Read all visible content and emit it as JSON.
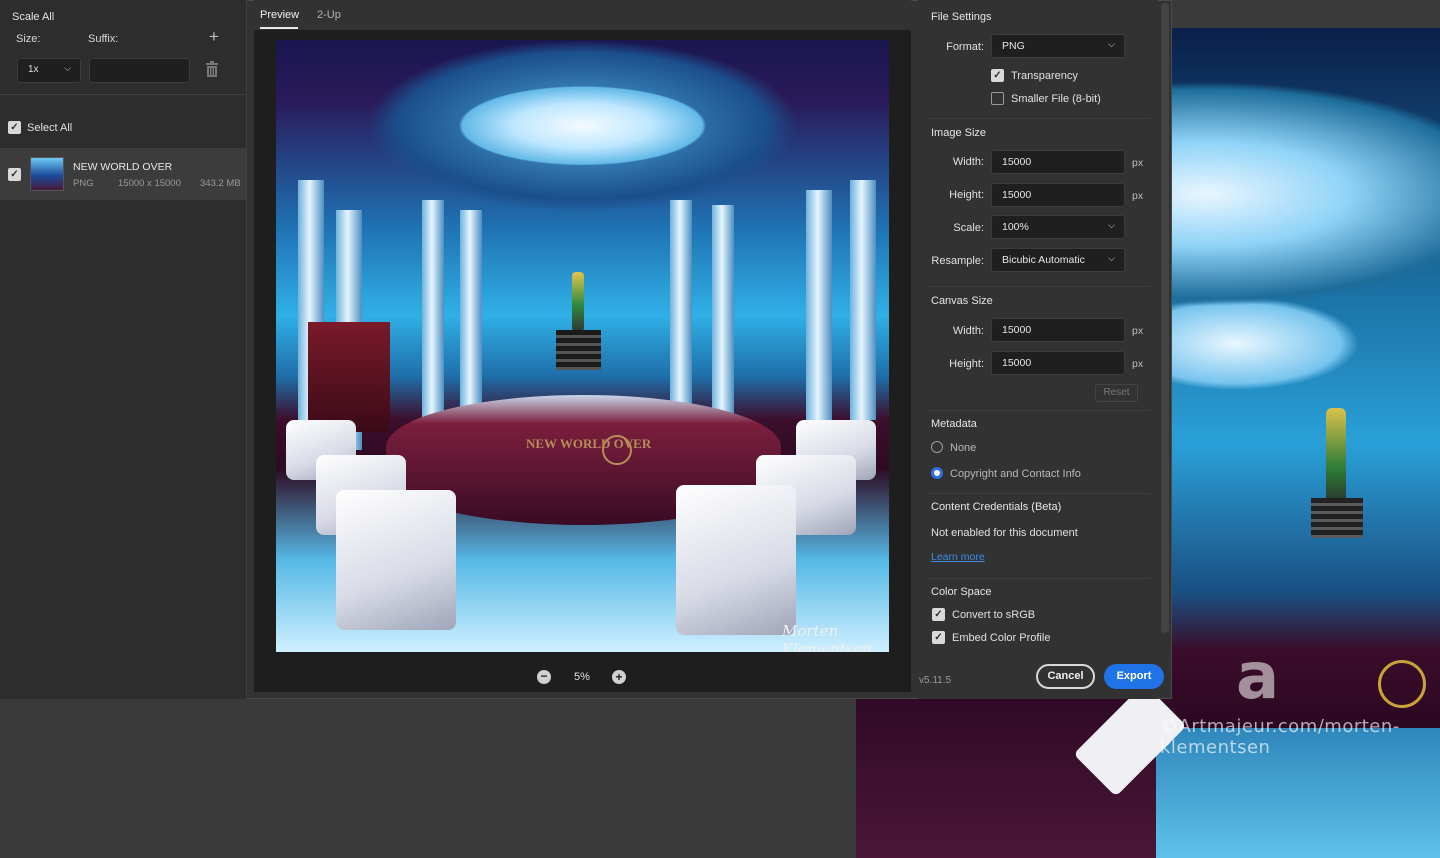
{
  "left_panel": {
    "title": "Scale All",
    "size_label": "Size:",
    "suffix_label": "Suffix:",
    "size_value": "1x",
    "suffix_value": "",
    "select_all_label": "Select All",
    "asset": {
      "name": "NEW WORLD OVER",
      "format": "PNG",
      "dimensions": "15000 x 15000",
      "file_size": "343.2 MB"
    }
  },
  "preview": {
    "tabs": [
      "Preview",
      "2-Up"
    ],
    "active_tab": "Preview",
    "artwork_text": "NEW WORLD OVER",
    "signature": "Morten Klementsen",
    "zoom": "5%"
  },
  "file_settings": {
    "title": "File Settings",
    "format_label": "Format:",
    "format_value": "PNG",
    "transparency_label": "Transparency",
    "transparency_checked": true,
    "smaller_file_label": "Smaller File (8-bit)",
    "smaller_file_checked": false
  },
  "image_size": {
    "title": "Image Size",
    "width_label": "Width:",
    "width_value": "15000",
    "height_label": "Height:",
    "height_value": "15000",
    "scale_label": "Scale:",
    "scale_value": "100%",
    "resample_label": "Resample:",
    "resample_value": "Bicubic Automatic",
    "unit": "px"
  },
  "canvas_size": {
    "title": "Canvas Size",
    "width_label": "Width:",
    "width_value": "15000",
    "height_label": "Height:",
    "height_value": "15000",
    "unit": "px",
    "reset_label": "Reset"
  },
  "metadata": {
    "title": "Metadata",
    "options": [
      "None",
      "Copyright and Contact Info"
    ],
    "selected": "Copyright and Contact Info"
  },
  "content_credentials": {
    "title": "Content Credentials (Beta)",
    "status": "Not enabled for this document",
    "learn_more": "Learn more"
  },
  "color_space": {
    "title": "Color Space",
    "convert_label": "Convert to sRGB",
    "convert_checked": true,
    "embed_label": "Embed Color Profile",
    "embed_checked": true
  },
  "footer": {
    "version": "v5.11.5",
    "cancel_label": "Cancel",
    "export_label": "Export"
  },
  "background": {
    "watermark": "©Artmajeur.com/morten-klementsen"
  },
  "colors": {
    "accent": "#1f73e6",
    "panel": "#323232",
    "field": "#1f1f1f"
  }
}
